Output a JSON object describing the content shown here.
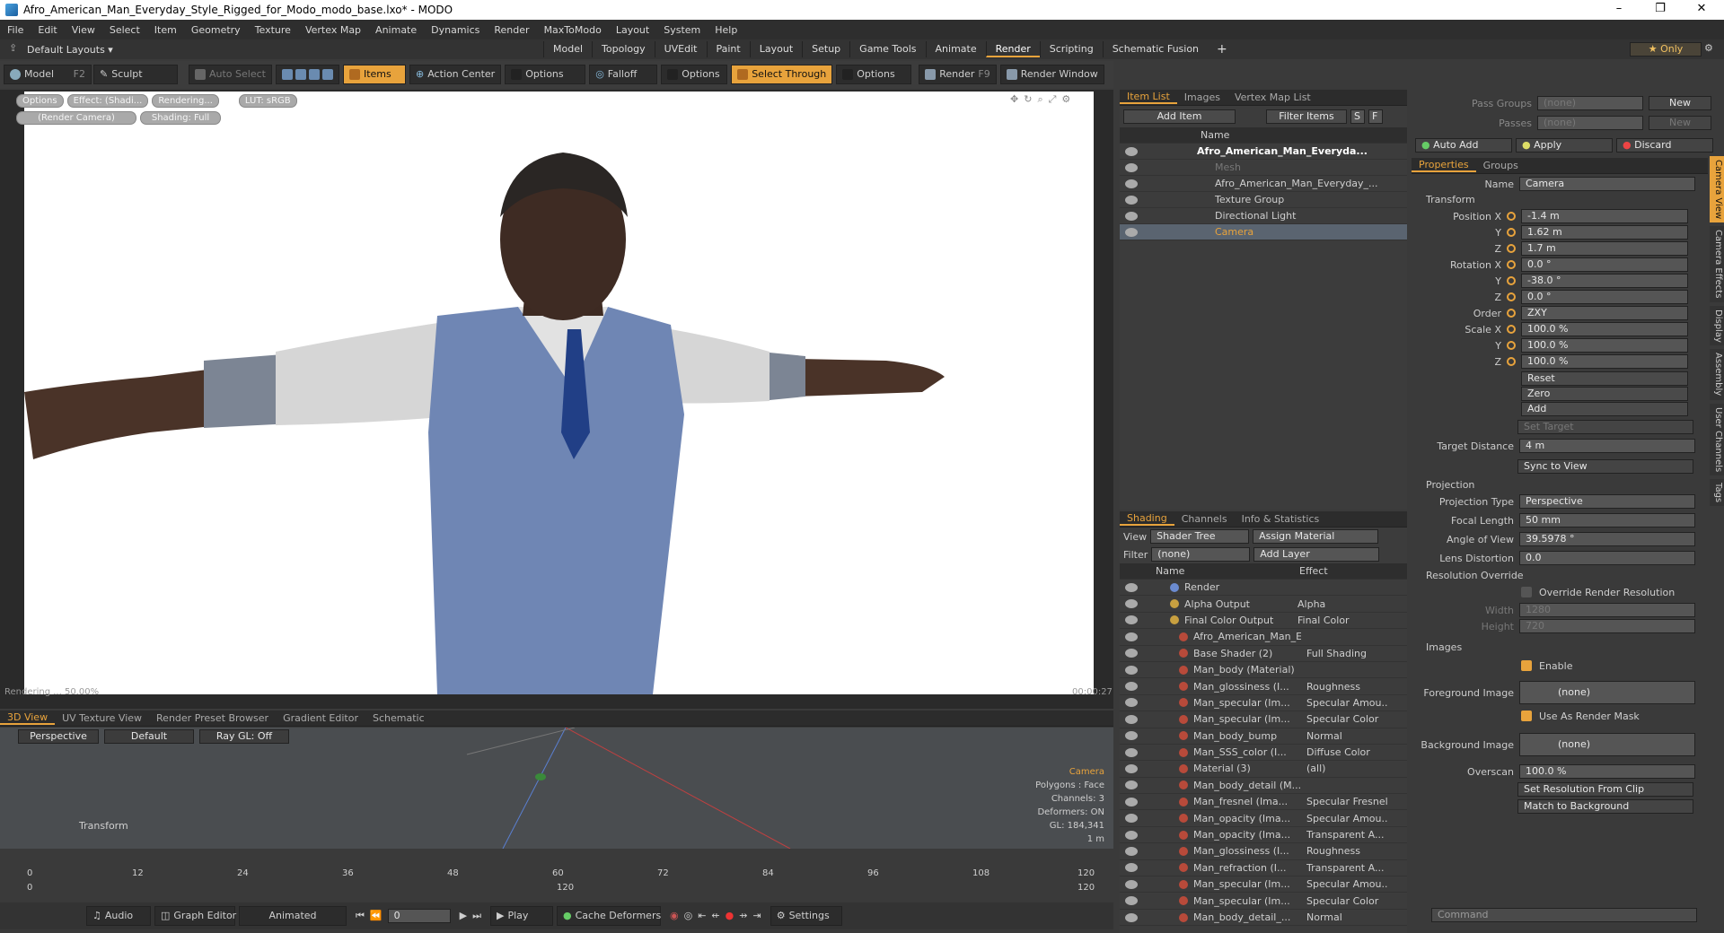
{
  "window": {
    "title": "Afro_American_Man_Everyday_Style_Rigged_for_Modo_modo_base.lxo* - MODO",
    "min": "–",
    "max": "❐",
    "close": "✕"
  },
  "menu": [
    "File",
    "Edit",
    "View",
    "Select",
    "Item",
    "Geometry",
    "Texture",
    "Vertex Map",
    "Animate",
    "Dynamics",
    "Render",
    "MaxToModo",
    "Layout",
    "System",
    "Help"
  ],
  "modebar": {
    "layout": "Default Layouts ▾",
    "tabs": [
      "Model",
      "Topology",
      "UVEdit",
      "Paint",
      "Layout",
      "Setup",
      "Game Tools",
      "Animate",
      "Render",
      "Scripting",
      "Schematic Fusion"
    ],
    "active_tab": "Render",
    "add": "+",
    "only": "★ Only"
  },
  "toolbar": {
    "model": "Model",
    "model_key": "F2",
    "sculpt": "Sculpt",
    "auto_select": "Auto Select",
    "items": "Items",
    "action_center": "Action Center",
    "options1": "Options",
    "falloff": "Falloff",
    "options2": "Options",
    "select_through": "Select Through",
    "options3": "Options",
    "render": "Render",
    "render_key": "F9",
    "render_window": "Render Window"
  },
  "viewport": {
    "btns": [
      "Options",
      "Effect: (Shadi...",
      "Rendering...",
      "LUT: sRGB"
    ],
    "btns2": [
      "(Render Camera)",
      "Shading: Full"
    ],
    "status_left": "Rendering ... 50.00%",
    "status_right": "00:00:27"
  },
  "itemlist": {
    "tabs": [
      "Item List",
      "Images",
      "Vertex Map List"
    ],
    "add_item": "Add Item",
    "filter": "Filter Items",
    "s": "S",
    "f": "F",
    "col_name": "Name",
    "rows": [
      {
        "name": "Afro_American_Man_Everyda...",
        "bold": true,
        "sel": false
      },
      {
        "name": "Mesh",
        "dim": true,
        "sel": false
      },
      {
        "name": "Afro_American_Man_Everyday_...",
        "sel": false
      },
      {
        "name": "Texture Group",
        "sel": false
      },
      {
        "name": "Directional Light",
        "sel": false
      },
      {
        "name": "Camera",
        "sel": true
      }
    ]
  },
  "shading": {
    "tabs": [
      "Shading",
      "Channels",
      "Info & Statistics"
    ],
    "view_label": "View",
    "view_value": "Shader Tree",
    "assign": "Assign Material",
    "filter_label": "Filter",
    "filter_value": "(none)",
    "add_layer": "Add Layer",
    "col_name": "Name",
    "col_effect": "Effect",
    "rows": [
      {
        "name": "Render",
        "effect": ""
      },
      {
        "name": "Alpha Output",
        "effect": "Alpha"
      },
      {
        "name": "Final Color Output",
        "effect": "Final Color"
      },
      {
        "name": "Afro_American_Man_E ...",
        "effect": ""
      },
      {
        "name": "Base Shader (2)",
        "effect": "Full Shading"
      },
      {
        "name": "Man_body (Material)",
        "effect": ""
      },
      {
        "name": "Man_glossiness (I...",
        "effect": "Roughness"
      },
      {
        "name": "Man_specular (Im...",
        "effect": "Specular Amou..."
      },
      {
        "name": "Man_specular (Im...",
        "effect": "Specular Color"
      },
      {
        "name": "Man_body_bump",
        "effect": "Normal"
      },
      {
        "name": "Man_SSS_color (I...",
        "effect": "Diffuse Color"
      },
      {
        "name": "Material (3)",
        "effect": "(all)"
      },
      {
        "name": "Man_body_detail (M...",
        "effect": ""
      },
      {
        "name": "Man_fresnel (Ima...",
        "effect": "Specular Fresnel"
      },
      {
        "name": "Man_opacity (Ima...",
        "effect": "Specular Amou..."
      },
      {
        "name": "Man_opacity (Ima...",
        "effect": "Transparent A..."
      },
      {
        "name": "Man_glossiness (I...",
        "effect": "Roughness"
      },
      {
        "name": "Man_refraction (I...",
        "effect": "Transparent A..."
      },
      {
        "name": "Man_specular (Im...",
        "effect": "Specular Amou..."
      },
      {
        "name": "Man_specular (Im...",
        "effect": "Specular Color"
      },
      {
        "name": "Man_body_detail_...",
        "effect": "Normal"
      }
    ]
  },
  "props": {
    "pass_groups": "Pass Groups",
    "passes": "Passes",
    "none": "(none)",
    "new": "New",
    "auto_add": "Auto Add",
    "apply": "Apply",
    "discard": "Discard",
    "tabs": [
      "Properties",
      "Groups"
    ],
    "name_label": "Name",
    "name_value": "Camera",
    "transform": "Transform",
    "pos_label": "Position X",
    "pos": [
      "-1.4 m",
      "1.62 m",
      "1.7 m"
    ],
    "rot_label": "Rotation X",
    "rot": [
      "0.0 °",
      "-38.0 °",
      "0.0 °"
    ],
    "order_label": "Order",
    "order": "ZXY",
    "scale_label": "Scale X",
    "scale": [
      "100.0 %",
      "100.0 %",
      "100.0 %"
    ],
    "y": "Y",
    "z": "Z",
    "reset": "Reset",
    "zero": "Zero",
    "add": "Add",
    "set_target": "Set Target",
    "target_label": "Target Distance",
    "target": "4 m",
    "sync": "Sync to View",
    "projection": "Projection",
    "proj_type_label": "Projection Type",
    "proj_type": "Perspective",
    "focal_label": "Focal Length",
    "focal": "50 mm",
    "angle_label": "Angle of View",
    "angle": "39.5978 °",
    "lens_label": "Lens Distortion",
    "lens": "0.0",
    "res_override": "Resolution Override",
    "override_label": "Override Render Resolution",
    "width_label": "Width",
    "width": "1280",
    "height_label": "Height",
    "height": "720",
    "images": "Images",
    "enable": "Enable",
    "fg_label": "Foreground Image",
    "fg": "(none)",
    "use_mask": "Use As Render Mask",
    "bg_label": "Background Image",
    "bg": "(none)",
    "overscan_label": "Overscan",
    "overscan": "100.0 %",
    "set_res": "Set Resolution From Clip",
    "match_bg": "Match to Background",
    "command": "Command",
    "sidetabs": [
      "Camera View",
      "Camera Effects",
      "Display",
      "Assembly",
      "User Channels",
      "Tags"
    ]
  },
  "bottom": {
    "tabs": [
      "3D View",
      "UV Texture View",
      "Render Preset Browser",
      "Gradient Editor",
      "Schematic"
    ],
    "perspective": "Perspective",
    "default": "Default",
    "raygl": "Ray GL: Off",
    "transform": "Transform",
    "info": [
      "Camera",
      "Polygons : Face",
      "Channels: 3",
      "Deformers: ON",
      "GL: 184,341",
      "1 m"
    ]
  },
  "timeline": {
    "ticks": [
      "0",
      "12",
      "24",
      "36",
      "48",
      "60",
      "72",
      "84",
      "96",
      "108",
      "120"
    ],
    "start": "0",
    "mid": "120",
    "end": "120"
  },
  "transport": {
    "audio": "Audio",
    "graph": "Graph Editor",
    "animated": "Animated",
    "frame": "0",
    "play": "Play",
    "cache": "Cache Deformers",
    "settings": "Settings"
  },
  "colors": {
    "accent": "#e8a33c",
    "panel": "#3c3c3c",
    "selected_row": "#5a6470"
  }
}
